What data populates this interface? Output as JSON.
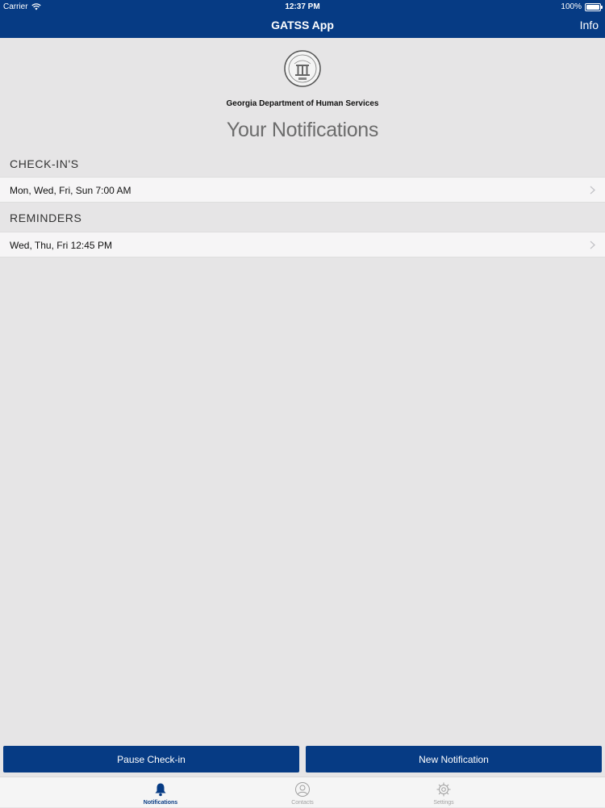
{
  "status_bar": {
    "carrier": "Carrier",
    "time": "12:37 PM",
    "battery": "100%"
  },
  "nav": {
    "title": "GATSS App",
    "info_label": "Info"
  },
  "org_name": "Georgia Department of Human Services",
  "page_title": "Your Notifications",
  "sections": {
    "checkins": {
      "header": "CHECK-IN'S",
      "row": "Mon, Wed, Fri, Sun 7:00 AM"
    },
    "reminders": {
      "header": "REMINDERS",
      "row": "Wed, Thu, Fri 12:45 PM"
    }
  },
  "buttons": {
    "pause": "Pause Check-in",
    "new": "New Notification"
  },
  "tabs": {
    "notifications": {
      "label": "Notifications",
      "icon": "bell-icon"
    },
    "contacts": {
      "label": "Contacts",
      "icon": "person-icon"
    },
    "settings": {
      "label": "Settings",
      "icon": "gear-icon"
    }
  },
  "colors": {
    "brand": "#063b84",
    "background": "#e6e5e6",
    "row": "#f6f5f6"
  }
}
